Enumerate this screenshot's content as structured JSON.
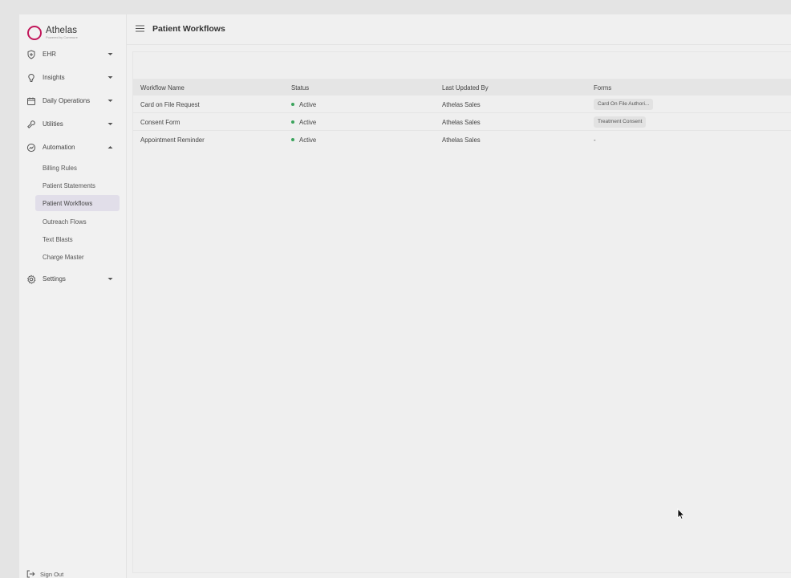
{
  "brand": {
    "name": "Athelas",
    "tagline": "Powered by Commure",
    "accent_color": "#c2185b"
  },
  "sidebar": {
    "items": [
      {
        "label": "EHR",
        "icon": "shield-plus-icon"
      },
      {
        "label": "Insights",
        "icon": "lightbulb-icon"
      },
      {
        "label": "Daily Operations",
        "icon": "calendar-icon"
      },
      {
        "label": "Utilities",
        "icon": "wrench-icon"
      },
      {
        "label": "Automation",
        "icon": "automation-icon",
        "expanded": true
      },
      {
        "label": "Settings",
        "icon": "gear-icon"
      }
    ],
    "automation_sub": [
      {
        "label": "Billing Rules"
      },
      {
        "label": "Patient Statements"
      },
      {
        "label": "Patient Workflows",
        "active": true
      },
      {
        "label": "Outreach Flows"
      },
      {
        "label": "Text Blasts"
      },
      {
        "label": "Charge Master"
      }
    ],
    "signout_label": "Sign Out"
  },
  "header": {
    "title": "Patient Workflows"
  },
  "table": {
    "columns": [
      "Workflow Name",
      "Status",
      "Last Updated By",
      "Forms"
    ],
    "rows": [
      {
        "name": "Card on File Request",
        "status": "Active",
        "updated_by": "Athelas Sales",
        "forms": "Card On File Authori..."
      },
      {
        "name": "Consent Form",
        "status": "Active",
        "updated_by": "Athelas Sales",
        "forms": "Treatment Consent"
      },
      {
        "name": "Appointment Reminder",
        "status": "Active",
        "updated_by": "Athelas Sales",
        "forms": "-"
      }
    ],
    "status_color": "#3aa35b"
  }
}
